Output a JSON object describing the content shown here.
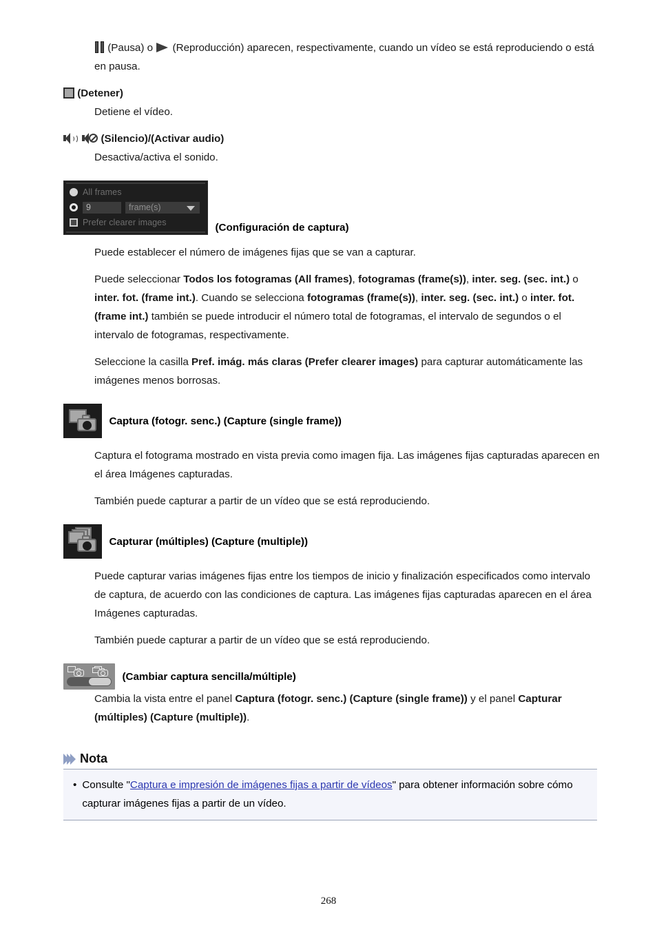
{
  "document": {
    "page_number": "268"
  },
  "playback": {
    "pause_icon": "pause-icon",
    "play_icon": "play-icon",
    "intro_part1": "(Pausa) o ",
    "intro_part2": "(Reproducción) aparecen, respectivamente, cuando un vídeo se está reproduciendo o está en pausa.",
    "pause_label": "(Pausa)",
    "play_label": "(Reproducción)"
  },
  "stop": {
    "icon": "stop-icon",
    "heading": "(Detener)",
    "description": "Detiene el vídeo."
  },
  "audio": {
    "mute_icon": "speaker-on-icon",
    "unmute_icon": "speaker-muted-icon",
    "heading": "(Silencio)/(Activar audio)",
    "description": "Desactiva/activa el sonido."
  },
  "capture_settings": {
    "panel": {
      "all_frames_label": "All frames",
      "count_value": "9",
      "unit_value": "frame(s)",
      "prefer_clearer_label": "Prefer clearer images",
      "radio_all_frames": "radio-all-frames",
      "radio_count": "radio-count",
      "dropdown_caret": "chevron-down-icon",
      "checkbox": "prefer-clearer-checkbox"
    },
    "caption": "(Configuración de captura)",
    "paragraph1": "Puede establecer el número de imágenes fijas que se van a capturar.",
    "paragraph2": {
      "t1": "Puede seleccionar ",
      "b1": "Todos los fotogramas (All frames)",
      "t2": ", ",
      "b2": "fotogramas (frame(s))",
      "t3": ", ",
      "b3": "inter. seg. (sec. int.)",
      "t4": " o ",
      "b4": "inter. fot. (frame int.)",
      "t5": ". Cuando se selecciona ",
      "b5": "fotogramas (frame(s))",
      "t6": ", ",
      "b6": "inter. seg. (sec. int.)",
      "t7": " o ",
      "b7": "inter. fot. (frame int.)",
      "t8": " también se puede introducir el número total de fotogramas, el intervalo de segundos o el intervalo de fotogramas, respectivamente."
    },
    "paragraph3": {
      "t1": "Seleccione la casilla ",
      "b1": "Pref. imág. más claras (Prefer clearer images)",
      "t2": " para capturar automáticamente las imágenes menos borrosas."
    }
  },
  "capture_single": {
    "icon": "capture-single-frame-icon",
    "heading": "Captura (fotogr. senc.) (Capture (single frame))",
    "paragraph1": "Captura el fotograma mostrado en vista previa como imagen fija. Las imágenes fijas capturadas aparecen en el área Imágenes capturadas.",
    "paragraph2": "También puede capturar a partir de un vídeo que se está reproduciendo."
  },
  "capture_multiple": {
    "icon": "capture-multiple-icon",
    "heading": "Capturar (múltiples) (Capture (multiple))",
    "paragraph1": "Puede capturar varias imágenes fijas entre los tiempos de inicio y finalización especificados como intervalo de captura, de acuerdo con las condiciones de captura. Las imágenes fijas capturadas aparecen en el área Imágenes capturadas.",
    "paragraph2": "También puede capturar a partir de un vídeo que se está reproduciendo."
  },
  "switch_capture": {
    "icon": "switch-single-multiple-toggle",
    "icon_left": "capture-single-frame-icon",
    "icon_right": "capture-multiple-icon",
    "heading": "(Cambiar captura sencilla/múltiple)",
    "description": {
      "t1": "Cambia la vista entre el panel ",
      "b1": "Captura (fotogr. senc.) (Capture (single frame))",
      "t2": " y el panel ",
      "b2": "Capturar (múltiples) (Capture (multiple))",
      "t3": "."
    }
  },
  "note": {
    "title": "Nota",
    "bullet": "•",
    "item": {
      "t1": "Consulte \"",
      "link": "Captura e impresión de imágenes fijas a partir de vídeos",
      "t2": "\" para obtener información sobre cómo capturar imágenes fijas a partir de un vídeo."
    }
  },
  "colors": {
    "link": "#2b37b0",
    "note_bg": "#f4f5fb",
    "note_rule": "#9aa4b8",
    "chevron": "#8f9fc4",
    "panel_bg": "#1e1e1e"
  }
}
